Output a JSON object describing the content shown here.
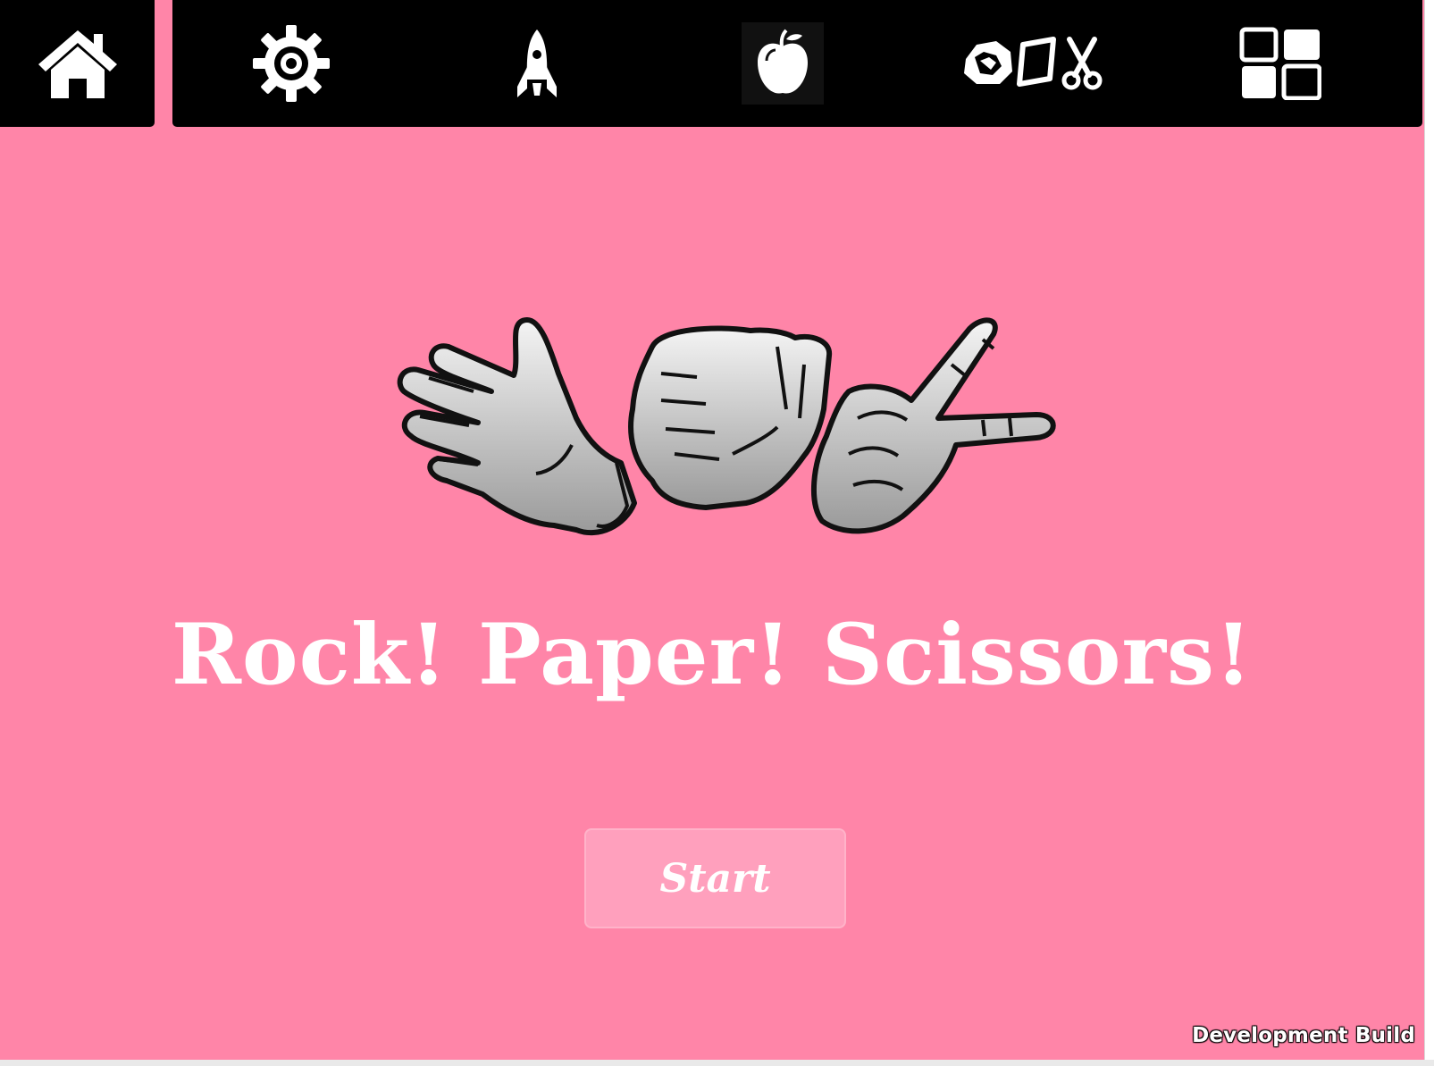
{
  "nav": {
    "items": [
      {
        "icon": "home-icon"
      },
      {
        "icon": "gear-icon"
      },
      {
        "icon": "rocket-icon"
      },
      {
        "icon": "apple-icon"
      },
      {
        "icon": "rock-paper-scissors-icon"
      },
      {
        "icon": "grid-icon"
      }
    ]
  },
  "game": {
    "title": "Rock! Paper! Scissors!",
    "start_label": "Start",
    "hero_image": "paper-rock-scissors-hands"
  },
  "footer": {
    "build_label": "Development Build"
  },
  "colors": {
    "background": "#ff85a8",
    "topbar": "#000000",
    "text": "#ffffff",
    "button": "#ffa0bd"
  }
}
